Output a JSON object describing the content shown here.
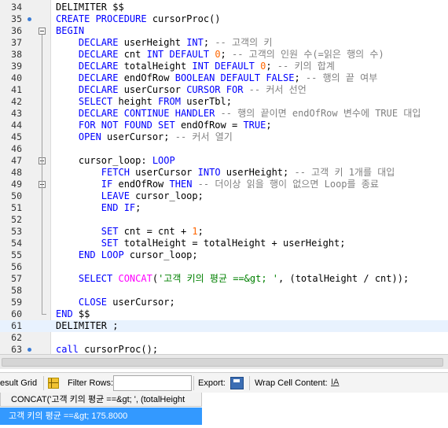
{
  "editor": {
    "lines": [
      {
        "num": "34",
        "parts": [
          {
            "t": "DELIMITER $$",
            "c": ""
          }
        ]
      },
      {
        "num": "35",
        "bp": true,
        "parts": [
          {
            "t": "CREATE PROCEDURE ",
            "c": "kw"
          },
          {
            "t": "cursorProc()",
            "c": ""
          }
        ]
      },
      {
        "num": "36",
        "fold": true,
        "parts": [
          {
            "t": "BEGIN",
            "c": "kw"
          }
        ]
      },
      {
        "num": "37",
        "parts": [
          {
            "t": "    DECLARE ",
            "c": "kw"
          },
          {
            "t": "userHeight ",
            "c": ""
          },
          {
            "t": "INT",
            "c": "kw"
          },
          {
            "t": "; ",
            "c": ""
          },
          {
            "t": "-- 고객의 키",
            "c": "cm"
          }
        ]
      },
      {
        "num": "38",
        "parts": [
          {
            "t": "    DECLARE ",
            "c": "kw"
          },
          {
            "t": "cnt ",
            "c": ""
          },
          {
            "t": "INT DEFAULT ",
            "c": "kw"
          },
          {
            "t": "0",
            "c": "num"
          },
          {
            "t": "; ",
            "c": ""
          },
          {
            "t": "-- 고객의 인원 수(=읽은 행의 수)",
            "c": "cm"
          }
        ]
      },
      {
        "num": "39",
        "parts": [
          {
            "t": "    DECLARE ",
            "c": "kw"
          },
          {
            "t": "totalHeight ",
            "c": ""
          },
          {
            "t": "INT DEFAULT ",
            "c": "kw"
          },
          {
            "t": "0",
            "c": "num"
          },
          {
            "t": "; ",
            "c": ""
          },
          {
            "t": "-- 키의 합계",
            "c": "cm"
          }
        ]
      },
      {
        "num": "40",
        "parts": [
          {
            "t": "    DECLARE ",
            "c": "kw"
          },
          {
            "t": "endOfRow ",
            "c": ""
          },
          {
            "t": "BOOLEAN DEFAULT FALSE",
            "c": "kw"
          },
          {
            "t": "; ",
            "c": ""
          },
          {
            "t": "-- 행의 끝 여부",
            "c": "cm"
          }
        ]
      },
      {
        "num": "41",
        "parts": [
          {
            "t": "    DECLARE ",
            "c": "kw"
          },
          {
            "t": "userCursor ",
            "c": ""
          },
          {
            "t": "CURSOR FOR ",
            "c": "kw"
          },
          {
            "t": "-- 커서 선언",
            "c": "cm"
          }
        ]
      },
      {
        "num": "42",
        "parts": [
          {
            "t": "    SELECT ",
            "c": "kw"
          },
          {
            "t": "height ",
            "c": ""
          },
          {
            "t": "FROM ",
            "c": "kw"
          },
          {
            "t": "userTbl;",
            "c": ""
          }
        ]
      },
      {
        "num": "43",
        "parts": [
          {
            "t": "    DECLARE CONTINUE HANDLER ",
            "c": "kw"
          },
          {
            "t": "-- 행의 끝이면 endOfRow 변수에 TRUE 대입",
            "c": "cm"
          }
        ]
      },
      {
        "num": "44",
        "parts": [
          {
            "t": "    FOR NOT FOUND SET ",
            "c": "kw"
          },
          {
            "t": "endOfRow = ",
            "c": ""
          },
          {
            "t": "TRUE",
            "c": "kw"
          },
          {
            "t": ";",
            "c": ""
          }
        ]
      },
      {
        "num": "45",
        "parts": [
          {
            "t": "    OPEN ",
            "c": "kw"
          },
          {
            "t": "userCursor; ",
            "c": ""
          },
          {
            "t": "-- 커서 열기",
            "c": "cm"
          }
        ]
      },
      {
        "num": "46",
        "parts": [
          {
            "t": "",
            "c": ""
          }
        ]
      },
      {
        "num": "47",
        "fold": true,
        "parts": [
          {
            "t": "    cursor_loop: ",
            "c": ""
          },
          {
            "t": "LOOP",
            "c": "kw"
          }
        ]
      },
      {
        "num": "48",
        "parts": [
          {
            "t": "        FETCH ",
            "c": "kw"
          },
          {
            "t": "userCursor ",
            "c": ""
          },
          {
            "t": "INTO ",
            "c": "kw"
          },
          {
            "t": "userHeight; ",
            "c": ""
          },
          {
            "t": "-- 고객 키 1개를 대입",
            "c": "cm"
          }
        ]
      },
      {
        "num": "49",
        "fold": true,
        "parts": [
          {
            "t": "        IF ",
            "c": "kw"
          },
          {
            "t": "endOfRow ",
            "c": ""
          },
          {
            "t": "THEN ",
            "c": "kw"
          },
          {
            "t": "-- 더이상 읽을 행이 없으면 Loop를 종료",
            "c": "cm"
          }
        ]
      },
      {
        "num": "50",
        "parts": [
          {
            "t": "        LEAVE ",
            "c": "kw"
          },
          {
            "t": "cursor_loop;",
            "c": ""
          }
        ]
      },
      {
        "num": "51",
        "parts": [
          {
            "t": "        END IF",
            "c": "kw"
          },
          {
            "t": ";",
            "c": ""
          }
        ]
      },
      {
        "num": "52",
        "parts": [
          {
            "t": "",
            "c": ""
          }
        ]
      },
      {
        "num": "53",
        "parts": [
          {
            "t": "        SET ",
            "c": "kw"
          },
          {
            "t": "cnt = cnt + ",
            "c": ""
          },
          {
            "t": "1",
            "c": "num"
          },
          {
            "t": ";",
            "c": ""
          }
        ]
      },
      {
        "num": "54",
        "parts": [
          {
            "t": "        SET ",
            "c": "kw"
          },
          {
            "t": "totalHeight = totalHeight + userHeight;",
            "c": ""
          }
        ]
      },
      {
        "num": "55",
        "parts": [
          {
            "t": "    END LOOP ",
            "c": "kw"
          },
          {
            "t": "cursor_loop;",
            "c": ""
          }
        ]
      },
      {
        "num": "56",
        "parts": [
          {
            "t": "",
            "c": ""
          }
        ]
      },
      {
        "num": "57",
        "parts": [
          {
            "t": "    SELECT ",
            "c": "kw"
          },
          {
            "t": "CONCAT",
            "c": "fn"
          },
          {
            "t": "(",
            "c": ""
          },
          {
            "t": "'고객 키의 평균 ==&gt; '",
            "c": "st"
          },
          {
            "t": ", (totalHeight / cnt));",
            "c": ""
          }
        ]
      },
      {
        "num": "58",
        "parts": [
          {
            "t": "",
            "c": ""
          }
        ]
      },
      {
        "num": "59",
        "parts": [
          {
            "t": "    CLOSE ",
            "c": "kw"
          },
          {
            "t": "userCursor;",
            "c": ""
          }
        ]
      },
      {
        "num": "60",
        "parts": [
          {
            "t": "END ",
            "c": "kw"
          },
          {
            "t": "$$",
            "c": ""
          }
        ]
      },
      {
        "num": "61",
        "hl": true,
        "parts": [
          {
            "t": "DELIMITER ;",
            "c": ""
          }
        ]
      },
      {
        "num": "62",
        "parts": [
          {
            "t": "",
            "c": ""
          }
        ]
      },
      {
        "num": "63",
        "bp": true,
        "parts": [
          {
            "t": "call ",
            "c": "kw"
          },
          {
            "t": "cursorProc();",
            "c": ""
          }
        ]
      }
    ]
  },
  "toolbar": {
    "result_grid_label": "esult Grid",
    "filter_rows_label": "Filter Rows:",
    "filter_rows_value": "",
    "export_label": "Export:",
    "wrap_cell_label": "Wrap Cell Content:"
  },
  "result_grid": {
    "column_header": "CONCAT('고객 키의 평균 ==&gt; ', (totalHeight",
    "row_value": "고객 키의 평균 ==&gt; 175.8000"
  },
  "colors": {
    "keyword": "#0000ff",
    "comment": "#808080",
    "string": "#008000",
    "number": "#ff6600",
    "function": "#ff00ff",
    "selected_row": "#3399ff"
  }
}
